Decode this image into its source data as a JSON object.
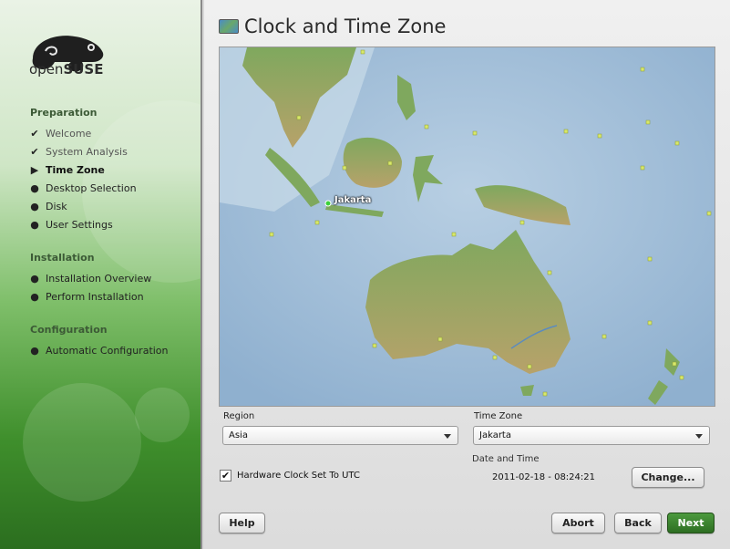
{
  "sidebar": {
    "logo_text_light": "open",
    "logo_text_bold": "SUSE",
    "sections": [
      {
        "title": "Preparation",
        "steps": [
          {
            "label": "Welcome",
            "state": "done"
          },
          {
            "label": "System Analysis",
            "state": "done"
          },
          {
            "label": "Time Zone",
            "state": "current"
          },
          {
            "label": "Desktop Selection",
            "state": "todo"
          },
          {
            "label": "Disk",
            "state": "todo"
          },
          {
            "label": "User Settings",
            "state": "todo"
          }
        ]
      },
      {
        "title": "Installation",
        "steps": [
          {
            "label": "Installation Overview",
            "state": "todo"
          },
          {
            "label": "Perform Installation",
            "state": "todo"
          }
        ]
      },
      {
        "title": "Configuration",
        "steps": [
          {
            "label": "Automatic Configuration",
            "state": "todo"
          }
        ]
      }
    ]
  },
  "main": {
    "title": "Clock and Time Zone",
    "map": {
      "selected_city": "Jakarta"
    },
    "region": {
      "label": "Region",
      "value": "Asia"
    },
    "timezone": {
      "label": "Time Zone",
      "value": "Jakarta"
    },
    "hardware_clock": {
      "label": "Hardware Clock Set To UTC",
      "checked": true
    },
    "date_time": {
      "label": "Date and Time",
      "value": "2011-02-18 - 08:24:21"
    },
    "change_button": "Change..."
  },
  "footer": {
    "help": "Help",
    "abort": "Abort",
    "back": "Back",
    "next": "Next"
  },
  "colors": {
    "accent_green": "#2d6e22",
    "sidebar_green": "#3f8f2c"
  }
}
